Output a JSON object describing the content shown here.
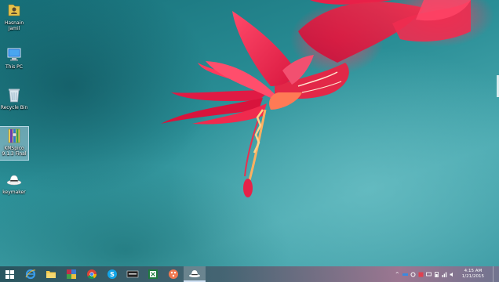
{
  "desktop": {
    "icons": [
      {
        "label": "Hasnain Jamil",
        "icon": "user-folder-icon"
      },
      {
        "label": "This PC",
        "icon": "computer-icon"
      },
      {
        "label": "Recycle Bin",
        "icon": "recycle-bin-icon"
      },
      {
        "label": "KMSpico 9.1.3 Final",
        "icon": "archive-icon"
      },
      {
        "label": "keymaker",
        "icon": "hat-icon"
      }
    ]
  },
  "taskbar": {
    "start_icon": "windows-logo-icon",
    "pinned": [
      {
        "name": "internet-explorer",
        "icon": "internet-explorer-icon"
      },
      {
        "name": "file-explorer",
        "icon": "folder-icon"
      },
      {
        "name": "winrar",
        "icon": "winrar-icon"
      },
      {
        "name": "chrome",
        "icon": "chrome-icon"
      },
      {
        "name": "skype",
        "icon": "skype-icon"
      },
      {
        "name": "app",
        "icon": "app-icon"
      },
      {
        "name": "excel",
        "icon": "excel-icon"
      },
      {
        "name": "paint",
        "icon": "paint-icon"
      },
      {
        "name": "keymaker",
        "icon": "hat-icon",
        "active": true
      }
    ],
    "tray": {
      "chevron": "^",
      "clock_time": "4:15 AM",
      "clock_date": "1/21/2015"
    }
  },
  "colors": {
    "wallpaper_teal": "#2a8e96",
    "flower_red": "#e8284a",
    "taskbar_tint": "#5a7080"
  }
}
